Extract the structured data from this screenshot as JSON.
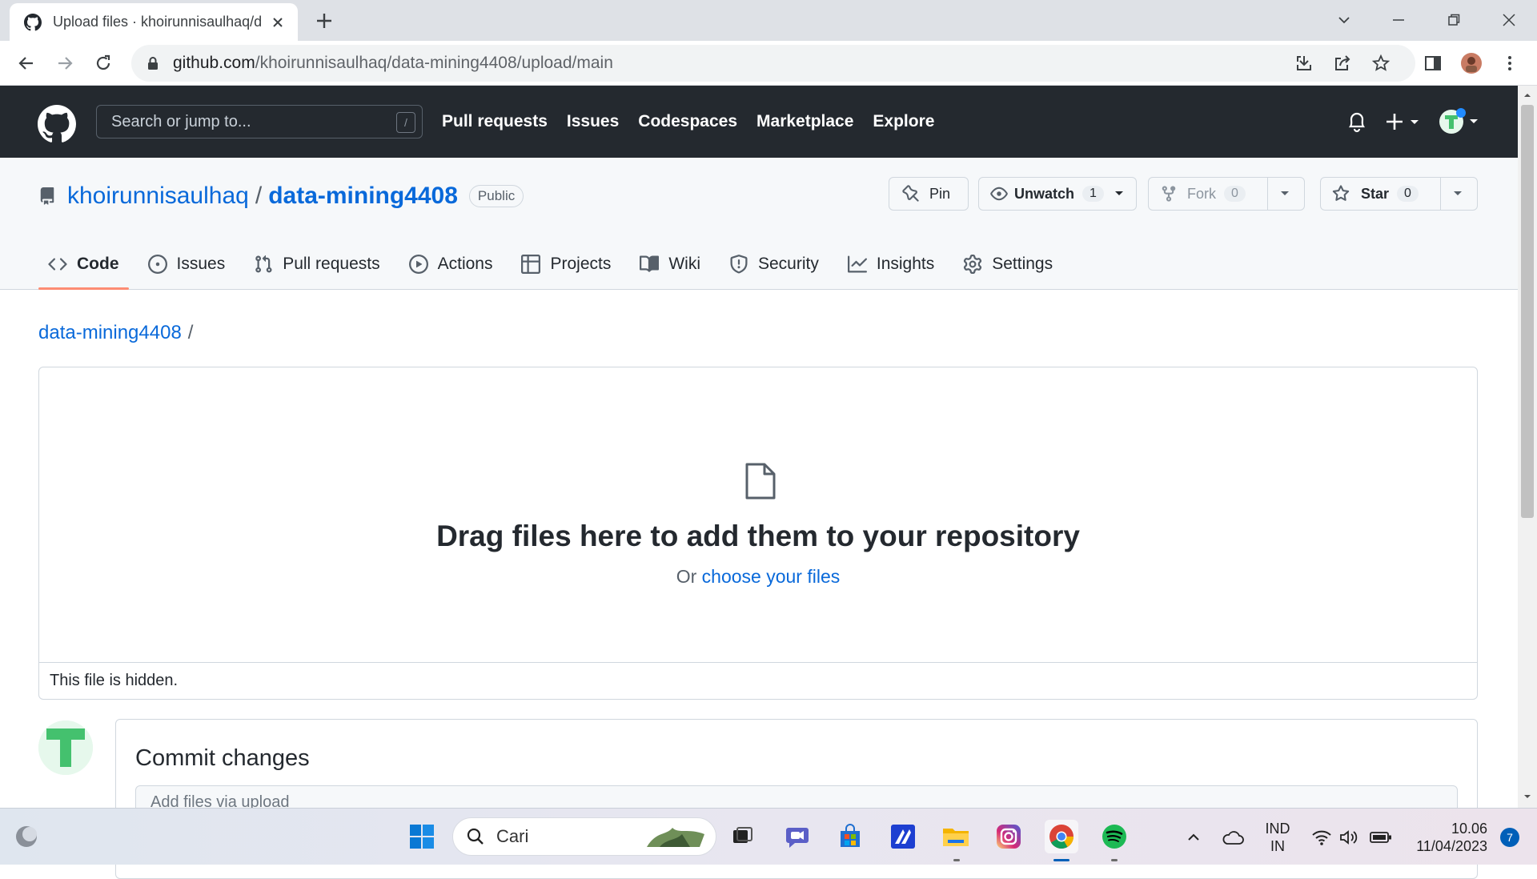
{
  "browser": {
    "tab_title": "Upload files · khoirunnisaulhaq/d",
    "url_host": "github.com",
    "url_path": "/khoirunnisaulhaq/data-mining4408/upload/main"
  },
  "github_header": {
    "search_placeholder": "Search or jump to...",
    "search_shortcut": "/",
    "nav": [
      "Pull requests",
      "Issues",
      "Codespaces",
      "Marketplace",
      "Explore"
    ]
  },
  "repo": {
    "owner": "khoirunnisaulhaq",
    "separator": "/",
    "name": "data-mining4408",
    "visibility": "Public",
    "pin_label": "Pin",
    "unwatch_label": "Unwatch",
    "watch_count": "1",
    "fork_label": "Fork",
    "fork_count": "0",
    "star_label": "Star",
    "star_count": "0",
    "tabs": [
      {
        "label": "Code",
        "icon": "code-icon",
        "active": true
      },
      {
        "label": "Issues",
        "icon": "issue-icon"
      },
      {
        "label": "Pull requests",
        "icon": "pull-request-icon"
      },
      {
        "label": "Actions",
        "icon": "play-icon"
      },
      {
        "label": "Projects",
        "icon": "table-icon"
      },
      {
        "label": "Wiki",
        "icon": "book-icon"
      },
      {
        "label": "Security",
        "icon": "shield-icon"
      },
      {
        "label": "Insights",
        "icon": "graph-icon"
      },
      {
        "label": "Settings",
        "icon": "gear-icon"
      }
    ]
  },
  "upload": {
    "breadcrumb_repo": "data-mining4408",
    "breadcrumb_sep": "/",
    "headline": "Drag files here to add them to your repository",
    "sub_prefix": "Or",
    "sub_link": "choose your files",
    "hidden_note": "This file is hidden."
  },
  "commit": {
    "title": "Commit changes",
    "input_placeholder": "Add files via upload"
  },
  "taskbar": {
    "search_label": "Cari",
    "lang_top": "IND",
    "lang_bottom": "IN",
    "time": "10.06",
    "date": "11/04/2023",
    "notification_count": "7"
  },
  "colors": {
    "accent": "#0969da",
    "header_bg": "#24292f",
    "active_tab_underline": "#fd8c73"
  }
}
